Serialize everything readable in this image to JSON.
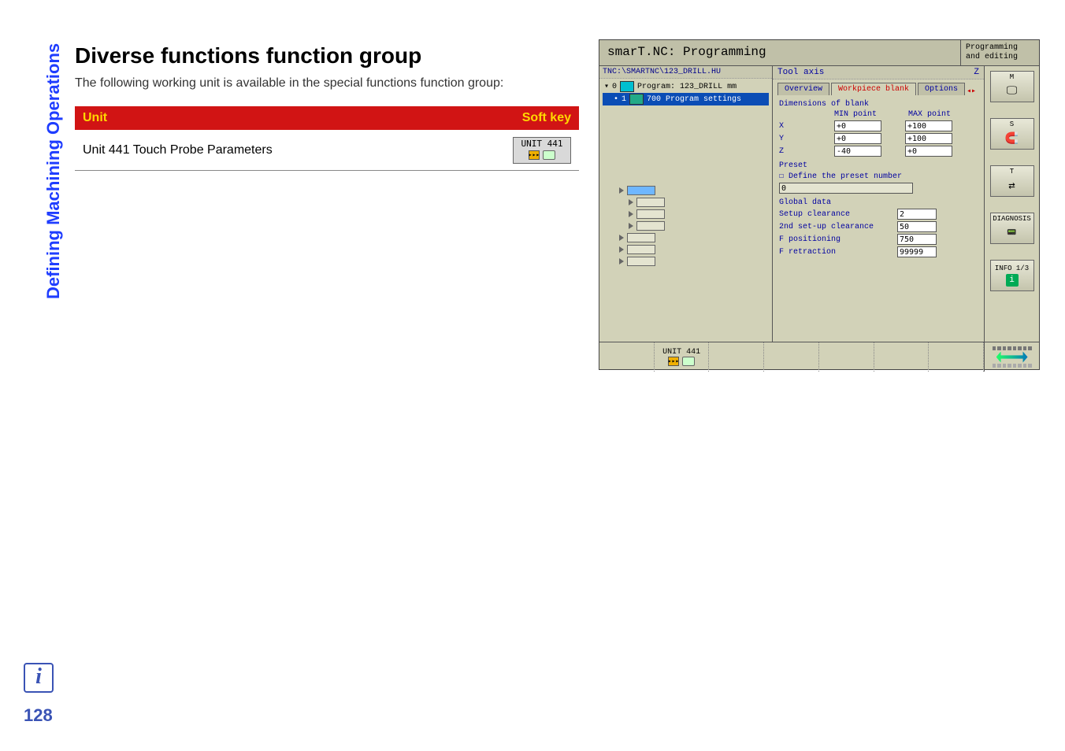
{
  "sidebar_title": "Defining Machining Operations",
  "page": {
    "title": "Diverse functions function group",
    "description": "The following working unit is available in the special functions function group:"
  },
  "table": {
    "col_unit": "Unit",
    "col_softkey": "Soft key",
    "row1_unit": "Unit 441 Touch Probe Parameters",
    "row1_sk_label": "UNIT 441",
    "row1_sk_sym": "▸▸▸"
  },
  "screenshot": {
    "title": "smarT.NC: Programming",
    "mode_line1": "Programming",
    "mode_line2": "and editing",
    "path": "TNC:\\SMARTNC\\123_DRILL.HU",
    "tree": {
      "item0_idx": "0",
      "item0_label": "Program: 123_DRILL mm",
      "item1_idx": "1",
      "item1_label": "700 Program settings"
    },
    "toolaxis_label": "Tool axis",
    "toolaxis_value": "Z",
    "tabs": {
      "t1": "Overview",
      "t2": "Workpiece blank",
      "t3": "Options"
    },
    "form": {
      "dims_label": "Dimensions of blank",
      "min_label": "MIN point",
      "max_label": "MAX point",
      "x_label": "X",
      "y_label": "Y",
      "z_label": "Z",
      "x_min": "+0",
      "x_max": "+100",
      "y_min": "+0",
      "y_max": "+100",
      "z_min": "-40",
      "z_max": "+0",
      "preset_header": "Preset",
      "preset_chk": "Define the preset number",
      "preset_val": "0",
      "global_header": "Global data",
      "setup_clear": "Setup clearance",
      "setup_clear_v": "2",
      "second_clear": "2nd set-up clearance",
      "second_clear_v": "50",
      "f_pos": "F positioning",
      "f_pos_v": "750",
      "f_retr": "F retraction",
      "f_retr_v": "99999"
    },
    "side": {
      "m": "M",
      "s": "S",
      "t": "T",
      "diag": "DIAGNOSIS",
      "info": "INFO 1/3"
    },
    "softkey2_label": "UNIT 441",
    "softkey2_sym": "▸▸▸"
  },
  "footer": {
    "info_icon": "i",
    "page_number": "128"
  }
}
